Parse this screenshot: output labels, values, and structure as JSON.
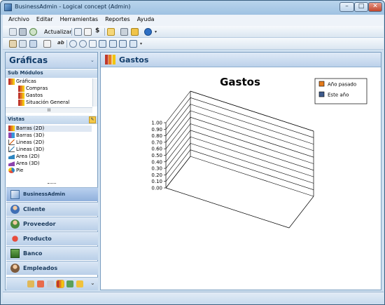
{
  "window": {
    "title": "BusinessAdmin - Logical concept (Admin)",
    "min": "–",
    "max": "□",
    "close": "✕"
  },
  "menu": [
    "Archivo",
    "Editar",
    "Herramientas",
    "Reportes",
    "Ayuda"
  ],
  "toolbar": {
    "refresh_label": "Actualizar",
    "dollar": "$",
    "ab": "ab",
    "more": "▾"
  },
  "left_panel": {
    "title": "Gráficas",
    "chevron": "⌄",
    "submodules": {
      "header": "Sub Módulos",
      "root": "Gráficas",
      "items": [
        "Compras",
        "Gastos",
        "Situación General"
      ],
      "hscroll": "III"
    },
    "vistas": {
      "header": "Vistas",
      "pin": "✎",
      "items": [
        "Barras (2D)",
        "Barras (3D)",
        "Lineas (2D)",
        "Lineas (3D)",
        "Area (2D)",
        "Area (3D)",
        "Pie"
      ]
    },
    "nav": [
      "BusinessAdmin",
      "Cliente",
      "Proveedor",
      "Producto",
      "Banco",
      "Empleados"
    ],
    "bottom_more": "⌄"
  },
  "main": {
    "title": "Gastos"
  },
  "chart_data": {
    "type": "bar",
    "title": "Gastos",
    "categories": [],
    "series": [
      {
        "name": "Año pasado",
        "values": []
      },
      {
        "name": "Este año",
        "values": []
      }
    ],
    "yticks": [
      "1.00",
      "0.90",
      "0.80",
      "0.70",
      "0.60",
      "0.50",
      "0.40",
      "0.30",
      "0.20",
      "0.10",
      "0.00"
    ],
    "ylim": [
      0,
      1
    ],
    "grid": true,
    "legend": "top-right",
    "colors": {
      "Año pasado": "#e57c1e",
      "Este año": "#3d5a8c"
    }
  }
}
